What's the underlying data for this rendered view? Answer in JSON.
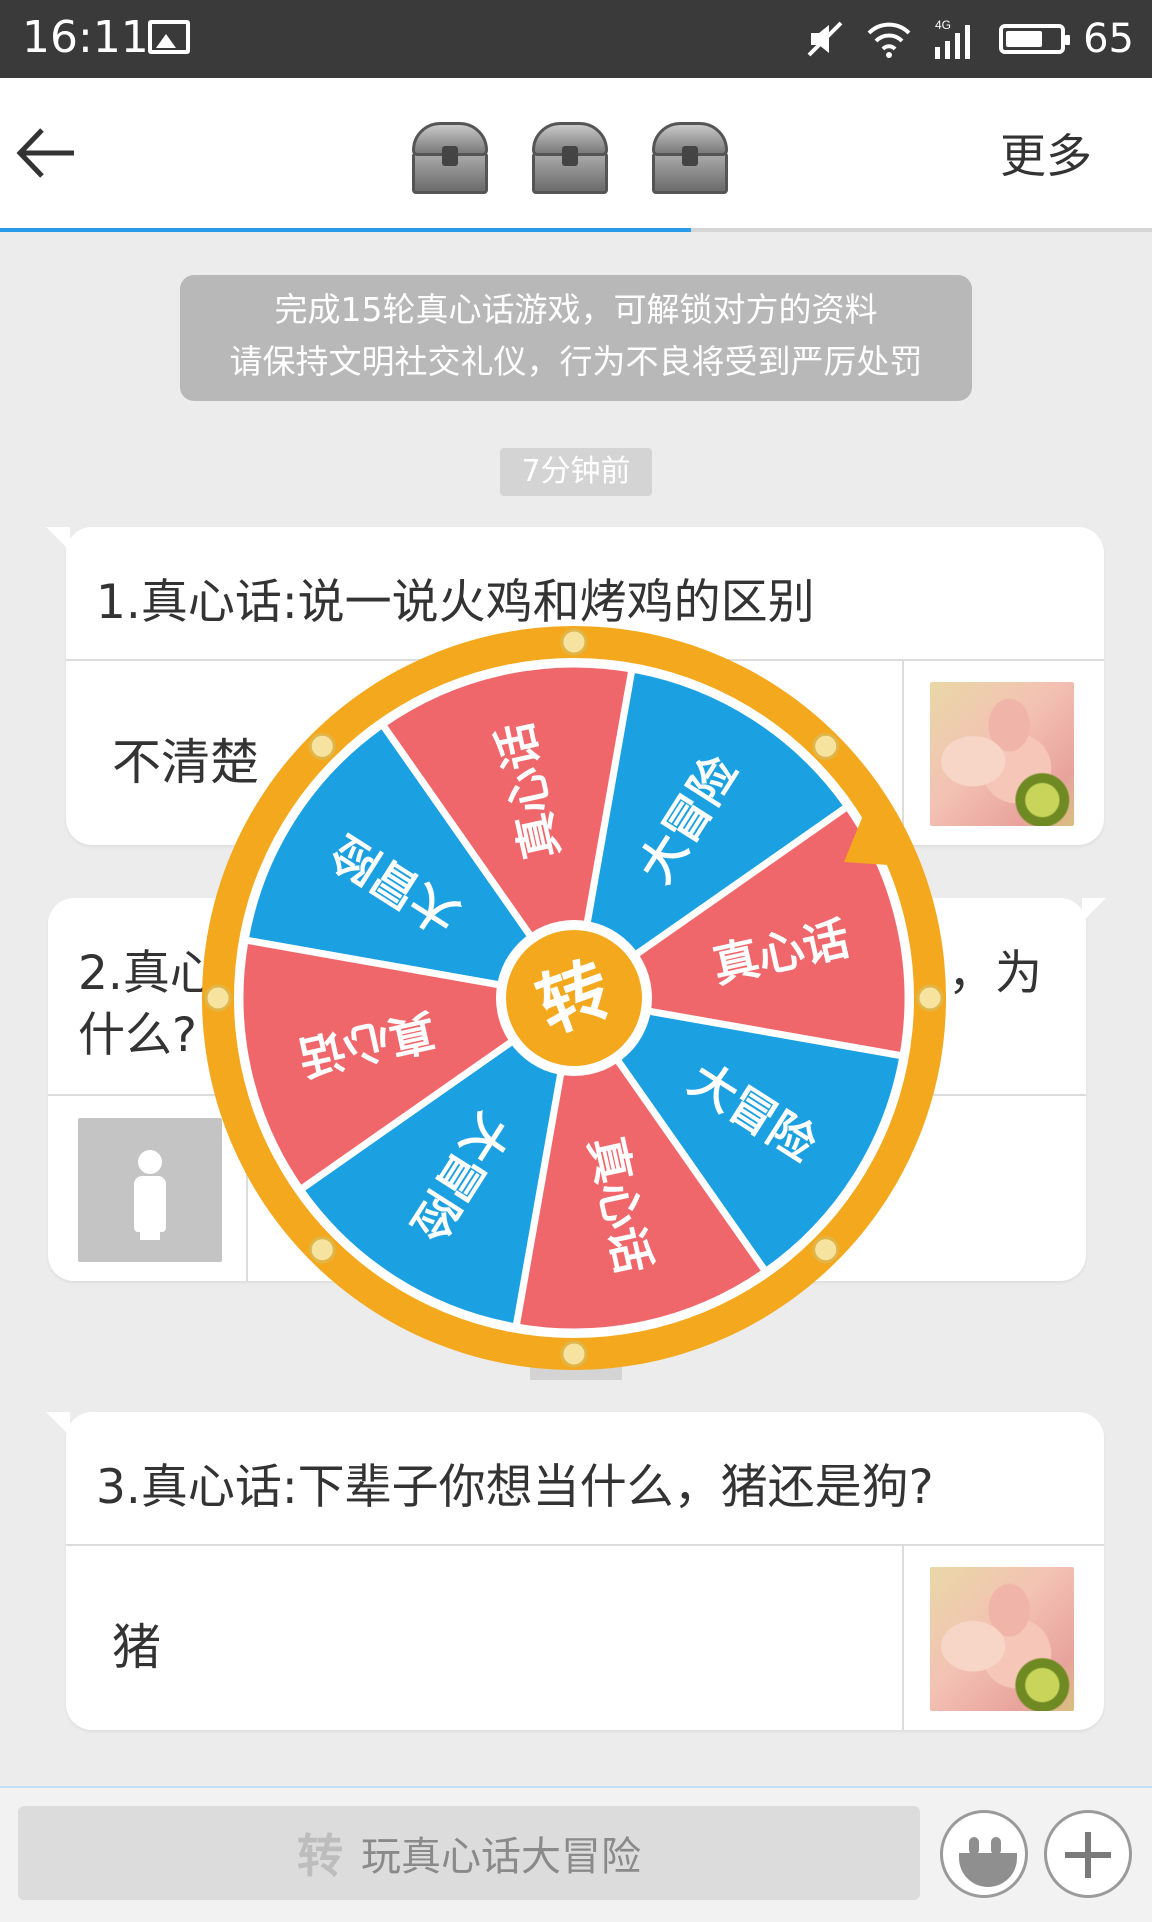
{
  "status_bar": {
    "time": "16:11",
    "icons": [
      "image-icon",
      "mute-icon",
      "wifi-icon",
      "signal-4g-icon",
      "battery-icon"
    ],
    "signal_label": "4G",
    "battery_level": "65"
  },
  "header": {
    "back_icon": "arrow-left-icon",
    "chest_icons": [
      "treasure-chest-icon",
      "treasure-chest-icon",
      "treasure-chest-icon"
    ],
    "more_label": "更多",
    "progress_fraction": 0.6,
    "progress_color": "#2a9be8"
  },
  "notice": {
    "line1": "完成15轮真心话游戏，可解锁对方的资料",
    "line2": "请保持文明社交礼仪，行为不良将受到严厉处罚"
  },
  "timestamp": "7分钟前",
  "cards": [
    {
      "question": "1.真心话:说一说火鸡和烤鸡的区别",
      "answer": "不清楚",
      "side": "right"
    },
    {
      "question_start": "2.真心",
      "question_end": "，为",
      "question_line2": "什么?",
      "side": "left"
    },
    {
      "question": "3.真心话:下辈子你想当什么，猪还是狗?",
      "answer": "猪",
      "side": "right"
    }
  ],
  "wheel": {
    "center_label": "转",
    "rim_color": "#f4a81d",
    "colors": {
      "red": "#f0676b",
      "blue": "#1ba1e2"
    },
    "segments": [
      {
        "label": "大冒险",
        "color": "blue"
      },
      {
        "label": "真心话",
        "color": "red"
      },
      {
        "label": "大冒险",
        "color": "blue"
      },
      {
        "label": "真心话",
        "color": "red"
      },
      {
        "label": "大冒险",
        "color": "blue"
      },
      {
        "label": "真心话",
        "color": "red"
      },
      {
        "label": "大冒险",
        "color": "blue"
      },
      {
        "label": "真心话",
        "color": "red"
      }
    ]
  },
  "input_bar": {
    "play_logo": "转",
    "play_label": "玩真心话大冒险",
    "emoji_icon": "smiley-face-icon",
    "plus_icon": "plus-icon"
  }
}
